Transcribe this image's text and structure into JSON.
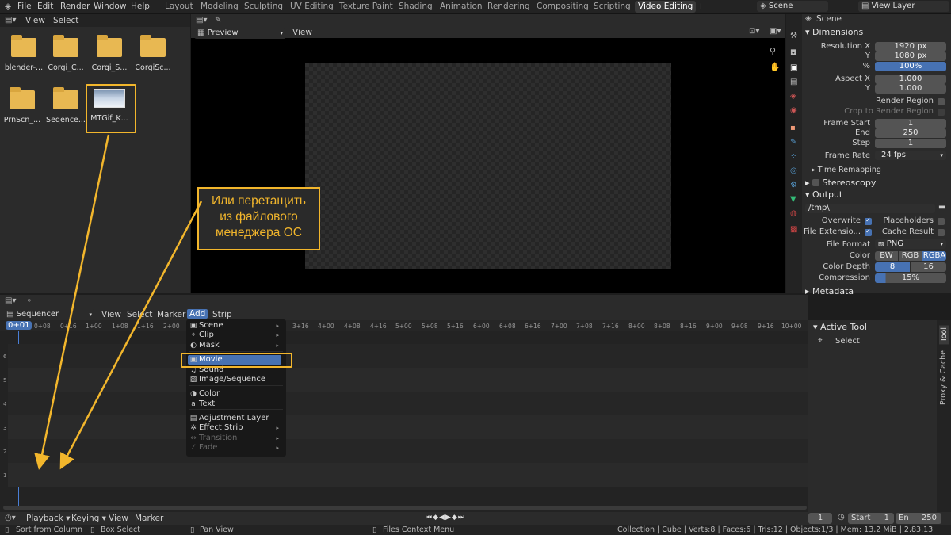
{
  "topbar": {
    "menus": [
      "File",
      "Edit",
      "Render",
      "Window",
      "Help"
    ],
    "workspace_tabs": [
      "Layout",
      "Modeling",
      "Sculpting",
      "UV Editing",
      "Texture Paint",
      "Shading",
      "Animation",
      "Rendering",
      "Compositing",
      "Scripting",
      "Video Editing"
    ],
    "active_tab": "Video Editing",
    "scene_label": "Scene",
    "view_layer_label": "View Layer"
  },
  "file_browser": {
    "menus": [
      "View",
      "Select"
    ],
    "files": [
      "blender-...",
      "Corgi_C...",
      "Corgi_S...",
      "CorgiSc...",
      "PrnScn_...",
      "Seqence...",
      "MTGif_K..."
    ]
  },
  "preview": {
    "mode": "Preview",
    "view_menu": "View"
  },
  "properties": {
    "scene_title": "Scene",
    "dimensions": {
      "header": "Dimensions",
      "resolution_x_label": "Resolution X",
      "resolution_x": "1920 px",
      "y_label": "Y",
      "resolution_y": "1080 px",
      "percent_label": "%",
      "percent": "100%",
      "aspect_x_label": "Aspect X",
      "aspect_x": "1.000",
      "aspect_y_label": "Y",
      "aspect_y": "1.000",
      "render_region": "Render Region",
      "crop_region": "Crop to Render Region",
      "frame_start_label": "Frame Start",
      "frame_start": "1",
      "end_label": "End",
      "frame_end": "250",
      "step_label": "Step",
      "frame_step": "1",
      "frame_rate_label": "Frame Rate",
      "frame_rate": "24 fps",
      "time_remapping": "Time Remapping"
    },
    "stereoscopy": "Stereoscopy",
    "output": {
      "header": "Output",
      "path": "/tmp\\",
      "overwrite": "Overwrite",
      "placeholders": "Placeholders",
      "file_extensions": "File Extensio...",
      "cache_result": "Cache Result",
      "file_format_label": "File Format",
      "file_format": "PNG",
      "color_label": "Color",
      "color_options": [
        "BW",
        "RGB",
        "RGBA"
      ],
      "color_depth_label": "Color Depth",
      "color_depth_options": [
        "8",
        "16"
      ],
      "compression_label": "Compression",
      "compression": "15%"
    },
    "metadata": "Metadata"
  },
  "sequencer": {
    "editor": "Sequencer",
    "menus": [
      "View",
      "Select",
      "Marker",
      "Add",
      "Strip"
    ],
    "current_frame": "0+01",
    "ticks": [
      "0+08",
      "0+16",
      "1+00",
      "1+08",
      "1+16",
      "2+00",
      "3+16",
      "4+00",
      "4+08",
      "4+16",
      "5+00",
      "5+08",
      "5+16",
      "6+00",
      "6+08",
      "6+16",
      "7+00",
      "7+08",
      "7+16",
      "8+00",
      "8+08",
      "8+16",
      "9+00",
      "9+08",
      "9+16",
      "10+00"
    ],
    "channels": [
      "6",
      "5",
      "4",
      "3",
      "2",
      "1"
    ]
  },
  "add_menu": {
    "items": [
      {
        "label": "Scene",
        "icon": "▣",
        "sub": true,
        "disabled": false
      },
      {
        "label": "Clip",
        "icon": "⌖",
        "sub": true,
        "disabled": false
      },
      {
        "label": "Mask",
        "icon": "◐",
        "sub": true,
        "disabled": false
      },
      {
        "label": "Movie",
        "icon": "▣",
        "sub": false,
        "disabled": false,
        "highlight": true
      },
      {
        "label": "Sound",
        "icon": "♫",
        "sub": false,
        "disabled": false
      },
      {
        "label": "Image/Sequence",
        "icon": "▨",
        "sub": false,
        "disabled": false
      },
      {
        "label": "Color",
        "icon": "◑",
        "sub": false,
        "disabled": false
      },
      {
        "label": "Text",
        "icon": "a",
        "sub": false,
        "disabled": false
      },
      {
        "label": "Adjustment Layer",
        "icon": "▤",
        "sub": false,
        "disabled": false
      },
      {
        "label": "Effect Strip",
        "icon": "✲",
        "sub": true,
        "disabled": false
      },
      {
        "label": "Transition",
        "icon": "↔",
        "sub": true,
        "disabled": true
      },
      {
        "label": "Fade",
        "icon": "⁄",
        "sub": true,
        "disabled": true
      }
    ]
  },
  "tool_panel": {
    "header": "Active Tool",
    "tool": "Select",
    "tabs": [
      "Tool",
      "Proxy & Cache"
    ]
  },
  "timeline": {
    "menus": [
      "Playback",
      "Keying",
      "View",
      "Marker"
    ],
    "current": "1",
    "start_label": "Start",
    "start": "1",
    "end_label": "En",
    "end": "250"
  },
  "statusbar": {
    "left1": "Sort from Column",
    "left2": "Box Select",
    "mid1": "Pan View",
    "mid2": "Files Context Menu",
    "right": "Collection | Cube | Verts:8 | Faces:6 | Tris:12 | Objects:1/3 | Mem: 13.2 MiB | 2.83.13"
  },
  "annotation": {
    "line1": "Или перетащить",
    "line2": "из файлового",
    "line3": "менеджера ОС",
    "color": "#f2b62c"
  }
}
